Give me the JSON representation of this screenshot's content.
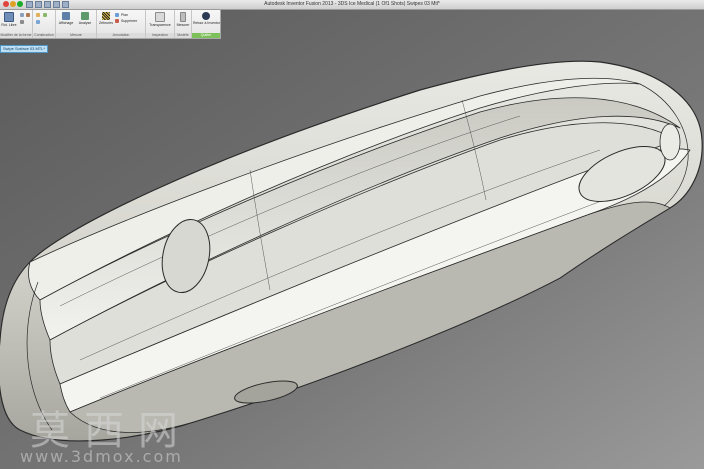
{
  "window": {
    "title": "Autodesk Inventor Fusion 2013 - 3DS Ice Medical (1 Of1 Shots) Swipes 03 Mtl*"
  },
  "ribbon": {
    "panels": [
      {
        "label": "Modifier de la forme"
      },
      {
        "label": "Construction"
      },
      {
        "label": "Mesure"
      },
      {
        "label": "Annotation"
      },
      {
        "label": "Inspection"
      },
      {
        "label": "Modèle"
      },
      {
        "label": "Quitter"
      }
    ],
    "buttons": {
      "free_turn": "Rot. Libre",
      "display_mode": "Affichage",
      "surface_analysis": "Analyse",
      "zebra": "Zébrures",
      "plane": "Plan",
      "delete_face": "Supprimer",
      "transparency": "Transparence",
      "measure": "Mesurer",
      "return": "Retour à Inventor"
    }
  },
  "browser": {
    "active_item": "Swipe Surface 03 MTL*"
  },
  "watermark": {
    "chinese": "莫西网",
    "url": "www.3dmox.com"
  }
}
